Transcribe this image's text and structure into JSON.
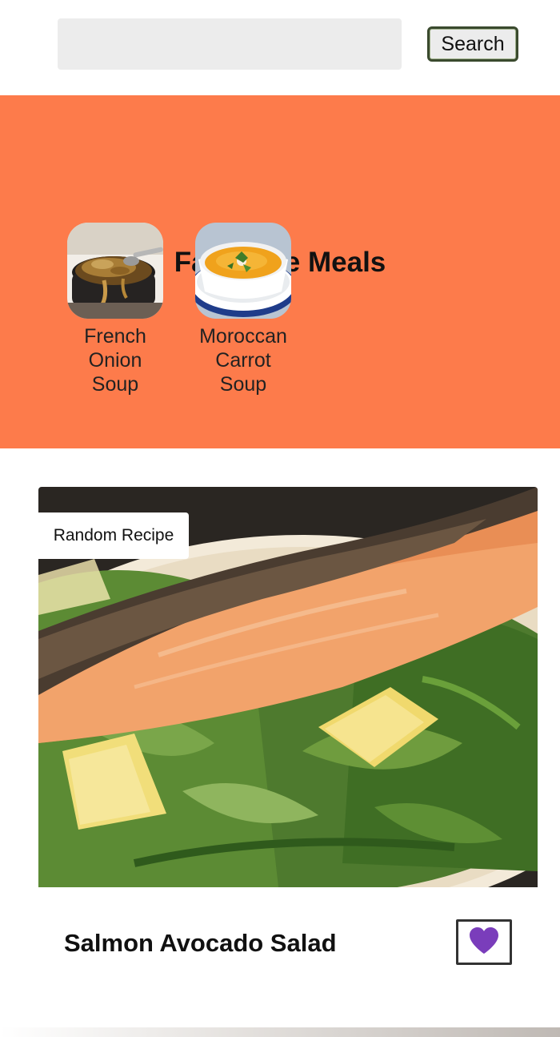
{
  "search": {
    "value": "",
    "placeholder": "",
    "button_label": "Search"
  },
  "favourites": {
    "title": "Favourite Meals",
    "items": [
      {
        "name": "French Onion Soup",
        "image": "french-onion-soup-photo"
      },
      {
        "name": "Moroccan Carrot Soup",
        "image": "moroccan-carrot-soup-photo"
      }
    ]
  },
  "random_meal": {
    "tag": "Random Recipe",
    "title": "Salmon Avocado Salad",
    "image": "salmon-avocado-salad-photo",
    "favourite_icon": "heart-icon",
    "favourited": true
  },
  "colors": {
    "favourites_background": "#fd7b4b",
    "heart": "#7a3dbb",
    "search_field": "#ececec"
  }
}
